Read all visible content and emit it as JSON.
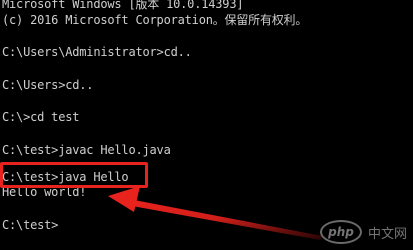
{
  "console": {
    "header": [
      "Microsoft Windows [版本 10.0.14393]",
      "(c) 2016 Microsoft Corporation。保留所有权利。"
    ],
    "lines": [
      "C:\\Users\\Administrator>cd..",
      "C:\\Users>cd..",
      "C:\\>cd test",
      "C:\\test>javac Hello.java",
      "C:\\test>java Hello",
      "Hello world!",
      "C:\\test>"
    ]
  },
  "annotation": {
    "color": "#e8221d"
  },
  "watermark": {
    "logo_text": "php",
    "site_text": "中文网"
  },
  "colors": {
    "background": "#000000",
    "text": "#cfcfcf"
  }
}
